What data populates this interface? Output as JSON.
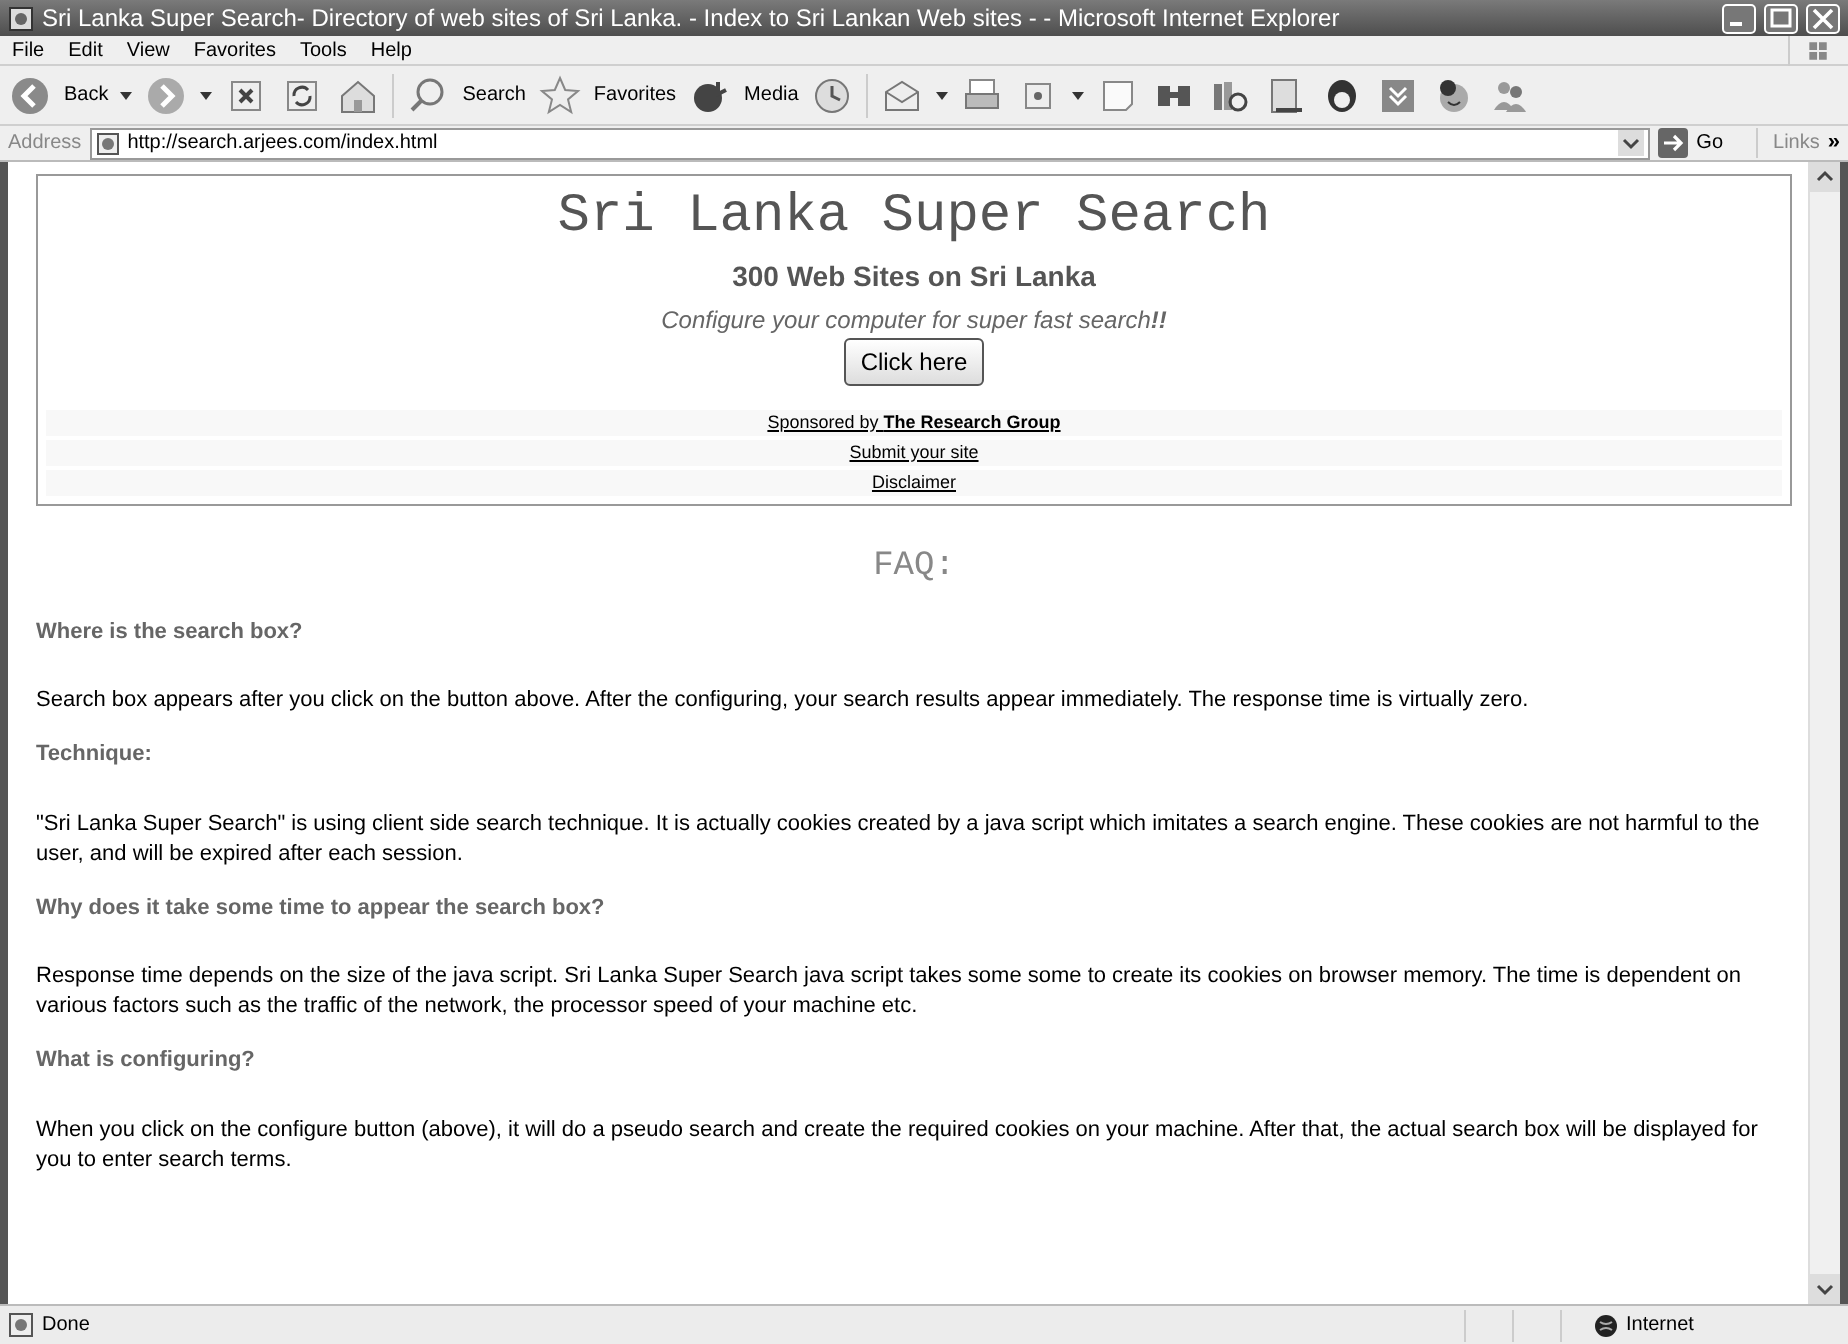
{
  "window": {
    "title": "Sri Lanka Super Search- Directory of web sites of Sri Lanka. - Index to Sri Lankan Web sites -  - Microsoft Internet Explorer"
  },
  "menu": [
    "File",
    "Edit",
    "View",
    "Favorites",
    "Tools",
    "Help"
  ],
  "toolbar": {
    "back": "Back",
    "search": "Search",
    "favorites": "Favorites",
    "media": "Media"
  },
  "address": {
    "label": "Address",
    "value": "http://search.arjees.com/index.html",
    "go": "Go",
    "links": "Links",
    "more": "»"
  },
  "page": {
    "title": "Sri Lanka Super Search",
    "subtitle": "300 Web Sites on Sri Lanka",
    "tagline": "Configure your computer for super fast search**!!**",
    "button": "Click here",
    "links": [
      "Sponsored by **The Research Group**",
      "Submit your site",
      "Disclaimer"
    ],
    "faq_title": "FAQ:",
    "faq": [
      {
        "question": "Where is the search box?",
        "answer": "Search box appears after you click on the button above. After the configuring, your search results appear immediately. The response time is virtually zero."
      },
      {
        "question": "Technique:",
        "answer": "\"Sri Lanka Super Search\" is using client side search technique. It is actually cookies created by a java script which imitates a search engine. These cookies are not harmful to the user, and will be expired after each session."
      },
      {
        "question": "Why does it take some time to appear the search box?",
        "answer": "Response time depends on the size of the java script. Sri Lanka Super Search java script takes some some to create its cookies on browser memory. The time is dependent on various factors such as the traffic of the network, the processor speed of your machine etc."
      },
      {
        "question": "What is configuring?",
        "answer": "When you click on the configure button (above), it will do a pseudo search and create the required cookies on your machine. After that, the actual search box will be displayed for you to enter search terms."
      }
    ]
  },
  "status_bar": {
    "text": "Done",
    "zone": "Internet"
  }
}
